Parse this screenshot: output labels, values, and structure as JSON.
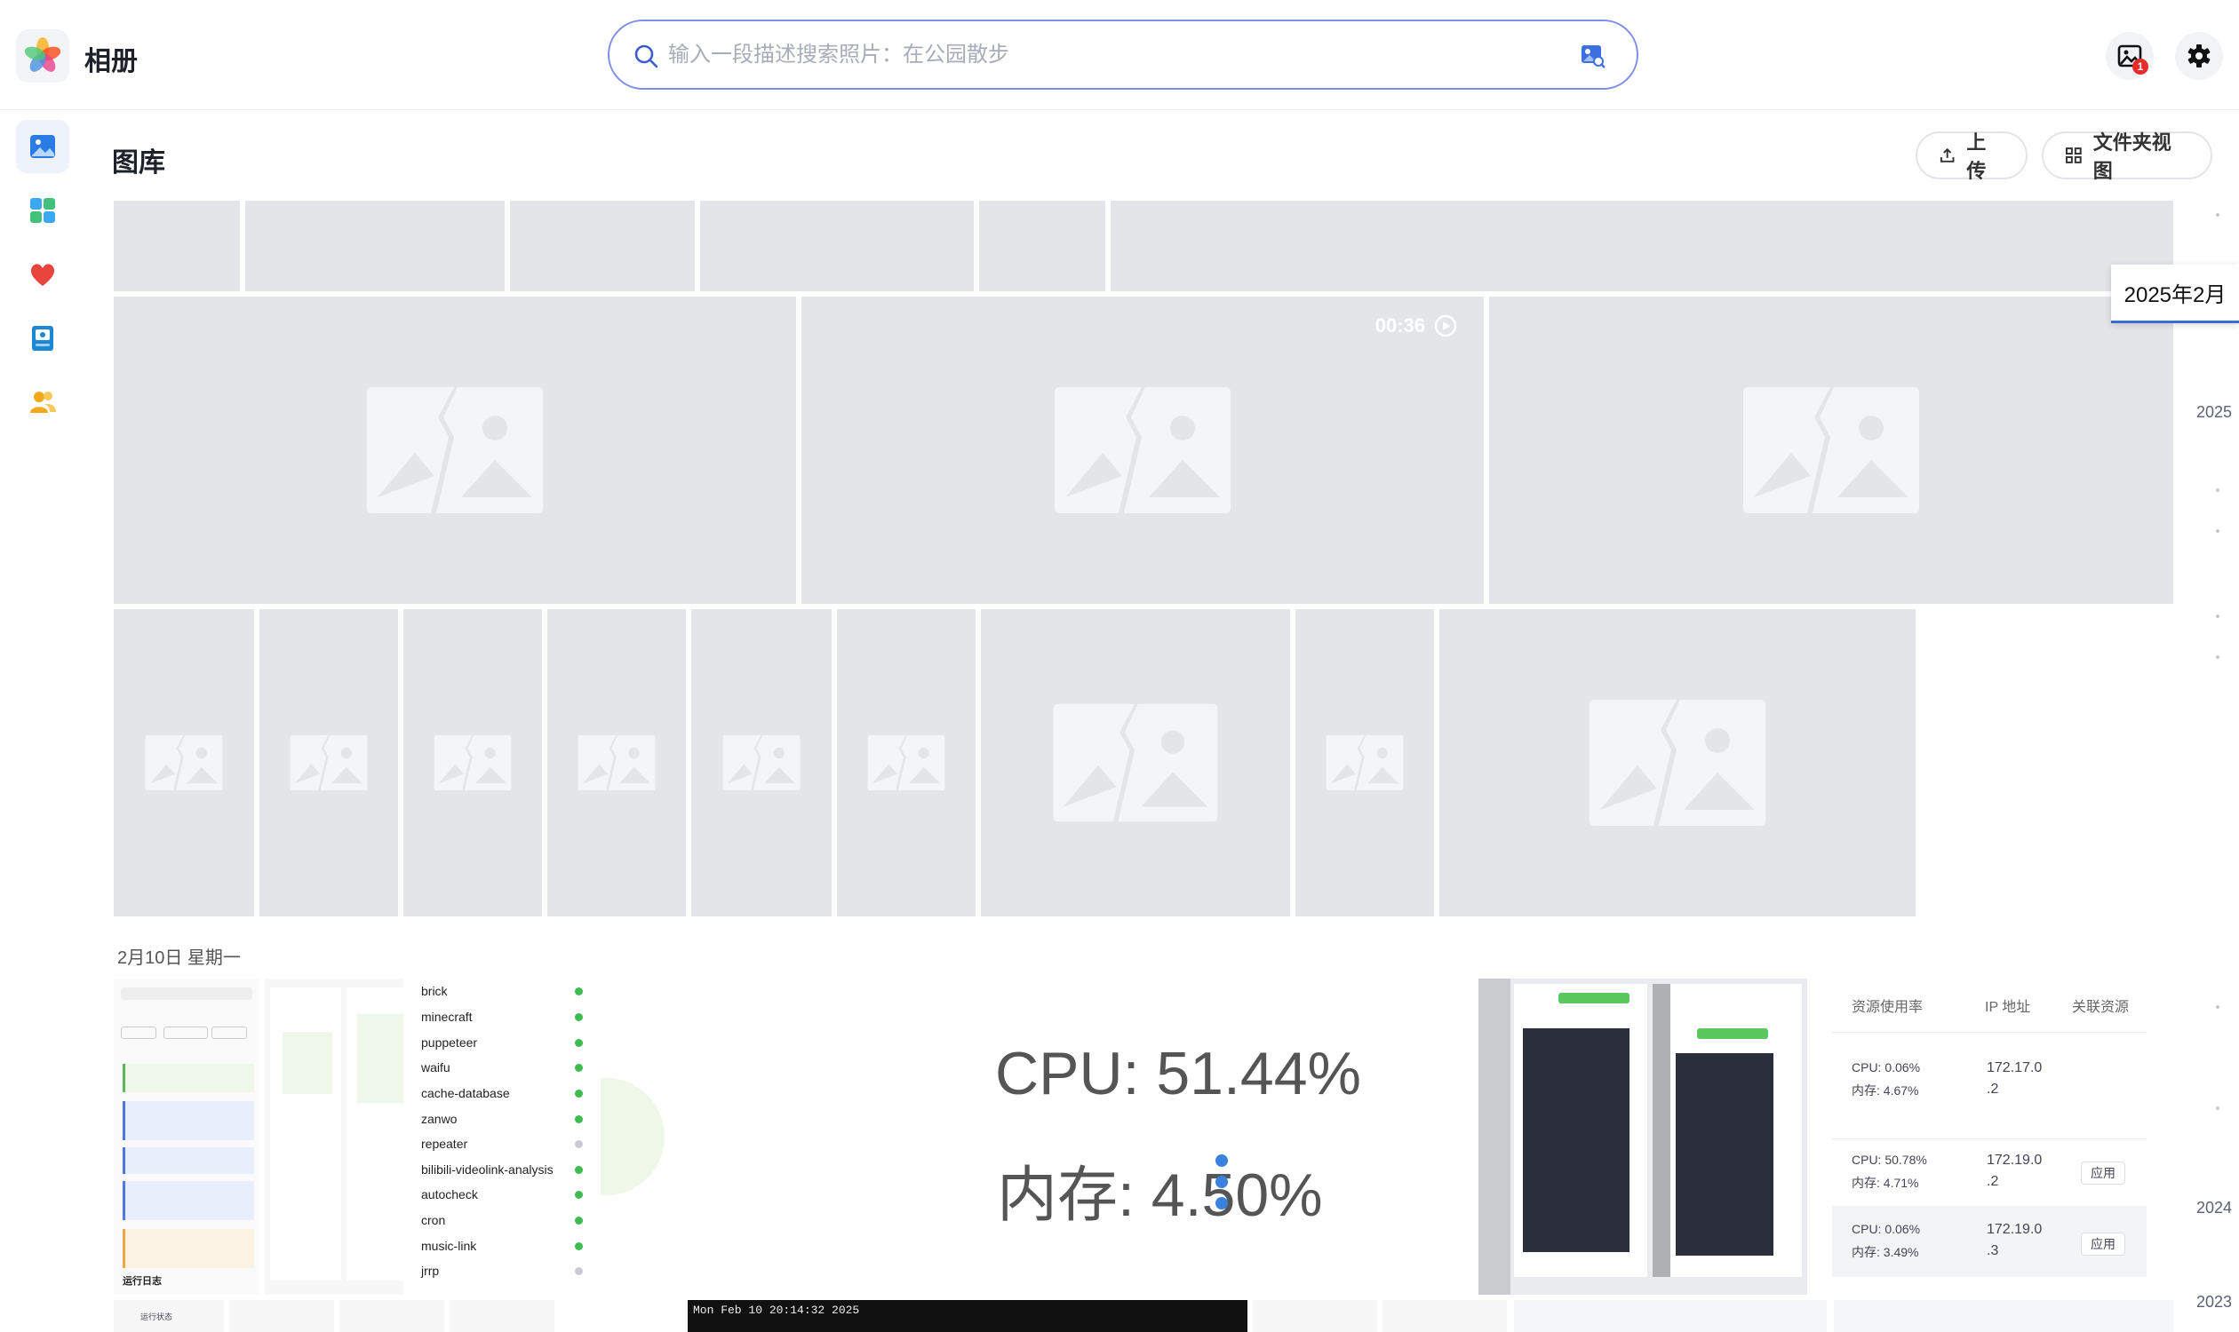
{
  "app": {
    "title": "相册"
  },
  "search": {
    "placeholder": "输入一段描述搜索照片：在公园散步"
  },
  "topbar": {
    "badge_count": "1"
  },
  "sidebar": {
    "items": [
      {
        "name": "gallery",
        "icon": "photo-icon",
        "active": true
      },
      {
        "name": "albums",
        "icon": "grid-icon"
      },
      {
        "name": "favorites",
        "icon": "heart-icon"
      },
      {
        "name": "memories",
        "icon": "book-icon"
      },
      {
        "name": "people",
        "icon": "people-icon"
      }
    ]
  },
  "header": {
    "title": "图库",
    "upload_label": "上传",
    "folder_view_label": "文件夹视图"
  },
  "video": {
    "duration": "00:36"
  },
  "section": {
    "date_label": "2月10日 星期一"
  },
  "timeline": {
    "current": "2025年2月",
    "years": [
      "2025",
      "2024",
      "2023"
    ]
  },
  "screenshots": {
    "projects": [
      "brick",
      "minecraft",
      "puppeteer",
      "waifu",
      "cache-database",
      "zanwo",
      "repeater",
      "bilibili-videolink-analysis",
      "autocheck",
      "cron",
      "music-link",
      "jrrp"
    ],
    "project_status": [
      "green",
      "green",
      "green",
      "green",
      "green",
      "green",
      "grey",
      "green",
      "green",
      "green",
      "green",
      "grey"
    ],
    "cpu_text": "CPU: 51.44%",
    "mem_text": "内存: 4.50%",
    "terminal_text": "Mon Feb 10 20:14:32 2025",
    "resource_headers": [
      "资源使用率",
      "IP 地址",
      "关联资源"
    ],
    "resource_rows": [
      {
        "cpu": "CPU: 0.06%",
        "mem": "内存: 4.67%",
        "ip1": "172.17.0",
        "ip2": ".2",
        "action": ""
      },
      {
        "cpu": "CPU: 50.78%",
        "mem": "内存: 4.71%",
        "ip1": "172.19.0",
        "ip2": ".2",
        "action": "应用"
      },
      {
        "cpu": "CPU: 0.06%",
        "mem": "内存: 3.49%",
        "ip1": "172.19.0",
        "ip2": ".3",
        "action": "应用"
      }
    ],
    "log_title": "运行日志",
    "log_label": "运行状态"
  }
}
